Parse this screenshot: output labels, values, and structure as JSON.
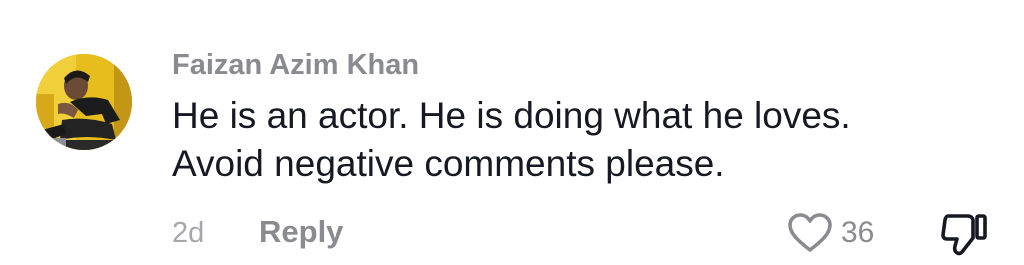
{
  "comment": {
    "author": "Faizan Azim Khan",
    "text_lines": [
      "He is an actor. He is doing what he loves.",
      "Avoid negative comments please."
    ],
    "time_ago": "2d",
    "reply_label": "Reply",
    "like_count": "36",
    "avatar_icon": "user-avatar-photo",
    "like_icon": "heart-outline-icon",
    "dislike_icon": "thumbs-down-icon"
  },
  "colors": {
    "username": "#8a8b91",
    "text": "#161823",
    "meta": "#a6a7ab",
    "icon": "#8a8b91"
  }
}
